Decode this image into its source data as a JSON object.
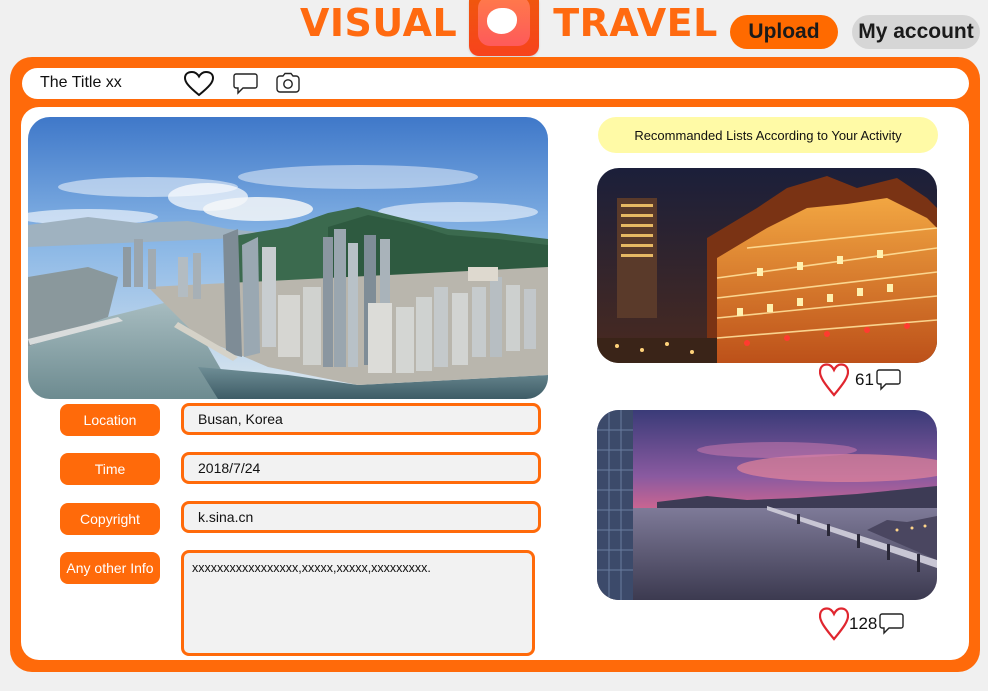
{
  "header": {
    "brand_left": "VISUAL",
    "brand_right": "TRAVEL",
    "upload_label": "Upload",
    "account_label": "My account"
  },
  "post": {
    "title": "The Title xx",
    "toolbar_icons": [
      "heart-icon",
      "comment-icon",
      "camera-icon"
    ]
  },
  "details": {
    "location_label": "Location",
    "location_value": "Busan, Korea",
    "time_label": "Time",
    "time_value": "2018/7/24",
    "copyright_label": "Copyright",
    "copyright_value": "k.sina.cn",
    "other_label": "Any other Info",
    "other_value": "xxxxxxxxxxxxxxxxx,xxxxx,xxxxx,xxxxxxxxx."
  },
  "recommendations": {
    "heading": "Recommanded Lists According to Your Activity",
    "items": [
      {
        "likes": "61"
      },
      {
        "likes": "128"
      }
    ]
  },
  "colors": {
    "accent": "#ff6a0a",
    "banner": "#fffaa6",
    "heart": "#e0262f"
  }
}
